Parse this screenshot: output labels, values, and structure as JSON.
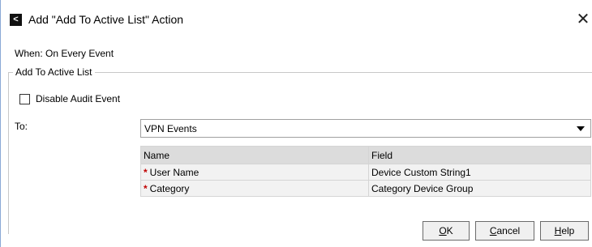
{
  "window": {
    "title": "Add \"Add To Active List\" Action",
    "icon": "app-logo-icon",
    "close_glyph": "✕"
  },
  "when": {
    "label": "When: On Every Event"
  },
  "group": {
    "title": "Add To Active List",
    "disable_audit": {
      "label": "Disable Audit Event",
      "checked": false
    }
  },
  "to": {
    "label": "To:",
    "selected": "VPN Events"
  },
  "table": {
    "headers": [
      "Name",
      "Field"
    ],
    "rows": [
      {
        "required": "*",
        "name": "User Name",
        "field": "Device Custom String1"
      },
      {
        "required": "*",
        "name": "Category",
        "field": "Category Device Group"
      }
    ]
  },
  "buttons": {
    "ok": {
      "mnemonic": "O",
      "rest": "K"
    },
    "cancel": {
      "mnemonic": "C",
      "rest": "ancel"
    },
    "help": {
      "mnemonic": "H",
      "rest": "elp"
    }
  }
}
